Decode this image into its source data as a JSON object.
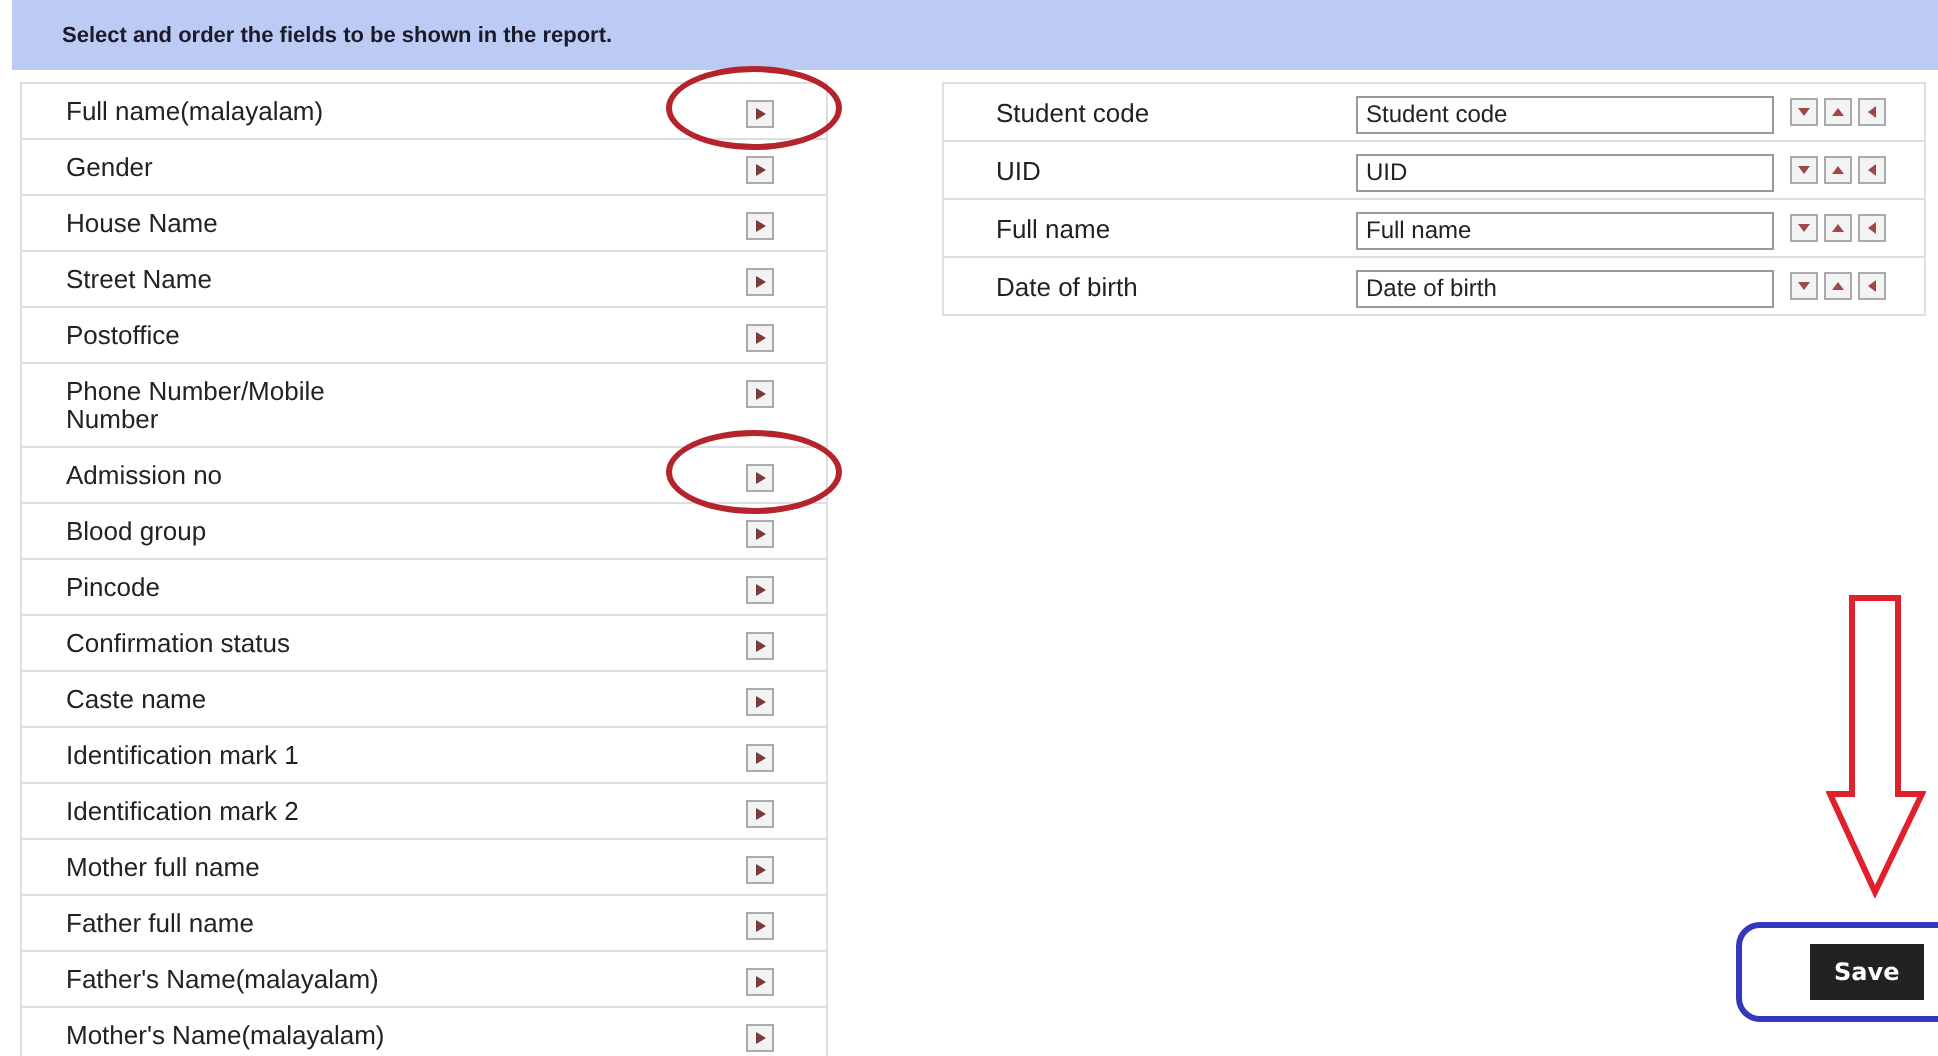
{
  "header": "Select and order the fields to be shown in the report.",
  "available_fields": [
    {
      "label": "Full name(malayalam)",
      "circled": true
    },
    {
      "label": "Gender",
      "circled": false
    },
    {
      "label": "House Name",
      "circled": false
    },
    {
      "label": "Street Name",
      "circled": false
    },
    {
      "label": "Postoffice",
      "circled": false
    },
    {
      "label": "Phone Number/Mobile Number",
      "circled": false
    },
    {
      "label": "Admission no",
      "circled": true
    },
    {
      "label": "Blood group",
      "circled": false
    },
    {
      "label": "Pincode",
      "circled": false
    },
    {
      "label": "Confirmation status",
      "circled": false
    },
    {
      "label": "Caste name",
      "circled": false
    },
    {
      "label": "Identification mark 1",
      "circled": false
    },
    {
      "label": "Identification mark 2",
      "circled": false
    },
    {
      "label": "Mother full name",
      "circled": false
    },
    {
      "label": "Father full name",
      "circled": false
    },
    {
      "label": "Father's Name(malayalam)",
      "circled": false
    },
    {
      "label": "Mother's Name(malayalam)",
      "circled": false
    }
  ],
  "selected_fields": [
    {
      "label": "Student code",
      "value": "Student code"
    },
    {
      "label": "UID",
      "value": "UID"
    },
    {
      "label": "Full name",
      "value": "Full name"
    },
    {
      "label": "Date of birth",
      "value": "Date of birth"
    }
  ],
  "save": {
    "label": "Save",
    "circled": true
  }
}
